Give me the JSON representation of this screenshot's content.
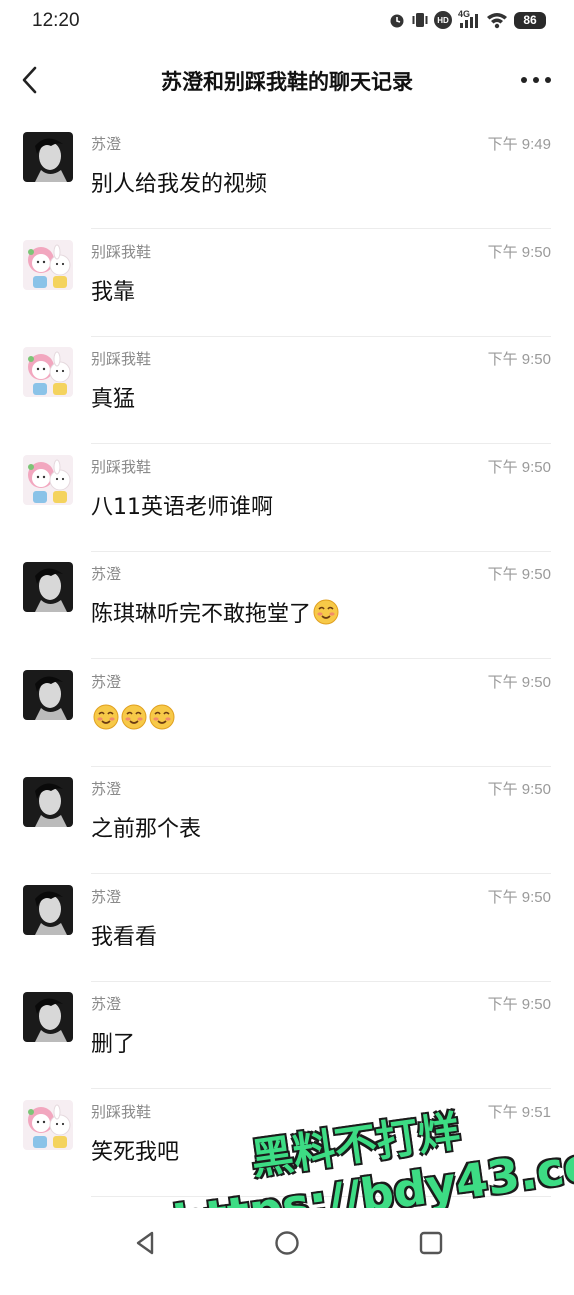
{
  "status_bar": {
    "time": "12:20",
    "battery": "86",
    "network": "4G",
    "hd": "HD"
  },
  "nav": {
    "title": "苏澄和别踩我鞋的聊天记录"
  },
  "messages": [
    {
      "sender": "苏澄",
      "time": "下午 9:49",
      "text": "别人给我发的视频",
      "avatar": "suzheng",
      "emoji_count": 0
    },
    {
      "sender": "别踩我鞋",
      "time": "下午 9:50",
      "text": "我靠",
      "avatar": "biecai",
      "emoji_count": 0
    },
    {
      "sender": "别踩我鞋",
      "time": "下午 9:50",
      "text": "真猛",
      "avatar": "biecai",
      "emoji_count": 0
    },
    {
      "sender": "别踩我鞋",
      "time": "下午 9:50",
      "text": "八11英语老师谁啊",
      "avatar": "biecai",
      "emoji_count": 0
    },
    {
      "sender": "苏澄",
      "time": "下午 9:50",
      "text": "陈琪琳听完不敢拖堂了",
      "avatar": "suzheng",
      "emoji_count": 1
    },
    {
      "sender": "苏澄",
      "time": "下午 9:50",
      "text": "",
      "avatar": "suzheng",
      "emoji_count": 3
    },
    {
      "sender": "苏澄",
      "time": "下午 9:50",
      "text": "之前那个表",
      "avatar": "suzheng",
      "emoji_count": 0
    },
    {
      "sender": "苏澄",
      "time": "下午 9:50",
      "text": "我看看",
      "avatar": "suzheng",
      "emoji_count": 0
    },
    {
      "sender": "苏澄",
      "time": "下午 9:50",
      "text": "删了",
      "avatar": "suzheng",
      "emoji_count": 0
    },
    {
      "sender": "别踩我鞋",
      "time": "下午 9:51",
      "text": "笑死我吧",
      "avatar": "biecai",
      "emoji_count": 0
    }
  ],
  "watermark": {
    "line1": "黑料不打烊",
    "line2": "https://bdy43.co"
  },
  "colors": {
    "watermark": "#3ddc84",
    "divider": "#ececec",
    "meta_text": "#8a8a8a"
  }
}
